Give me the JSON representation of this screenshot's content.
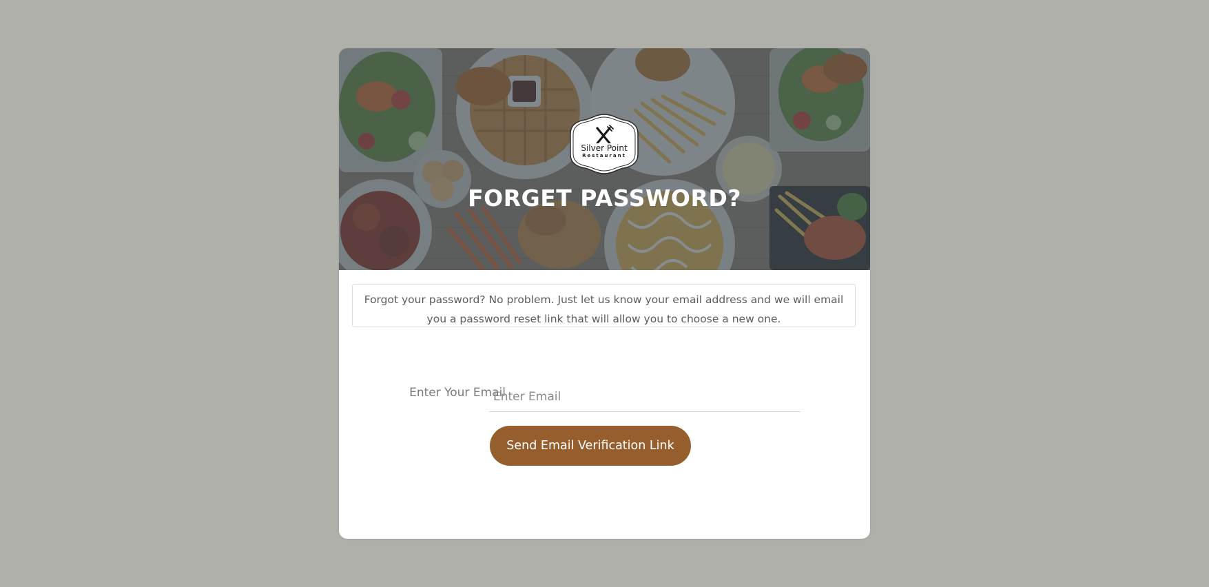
{
  "brand": {
    "logo_name": "Silver Point",
    "logo_subtitle": "Restaurant"
  },
  "hero": {
    "title": "FORGET PASSWORD?"
  },
  "info": {
    "message": "Forgot your password? No problem. Just let us know your email address and we will email you a password reset link that will allow you to choose a new one."
  },
  "form": {
    "email_label": "Enter Your Email",
    "email_placeholder": "Enter Email",
    "email_value": "",
    "submit_label": "Send Email Verification Link"
  },
  "colors": {
    "page_background": "#b0b0aa",
    "button": "#955e2c",
    "hero_overlay": "#3f4a52"
  },
  "icons": {
    "logo": "fork-knife-icon"
  }
}
